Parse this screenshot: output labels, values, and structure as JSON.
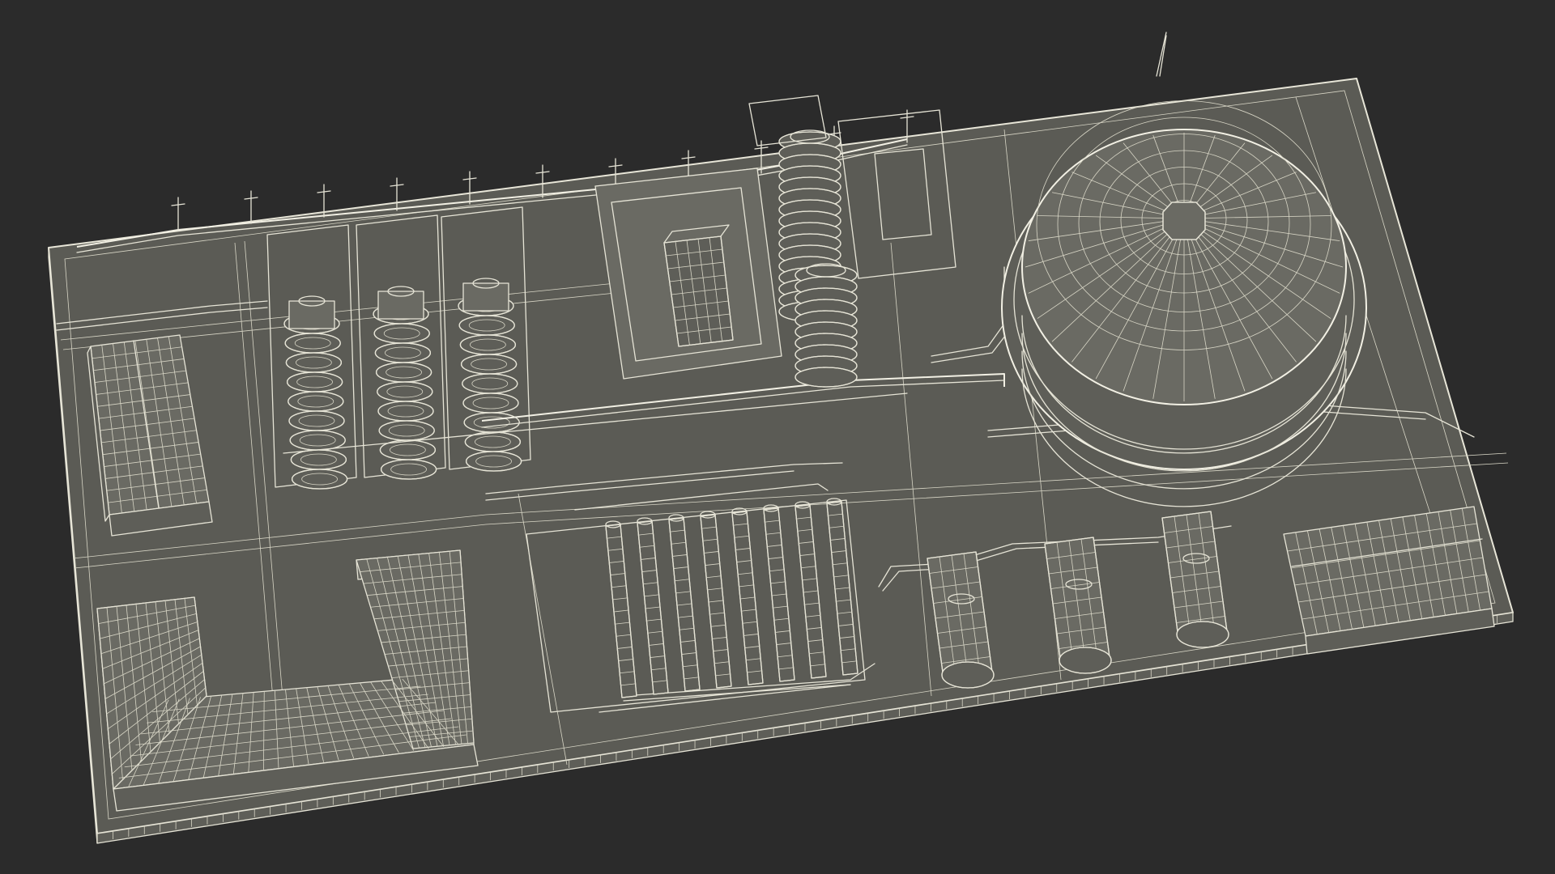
{
  "scene": {
    "background_color": "#2b2b2b",
    "wire_color": "#e6e4d6",
    "ground_color": "#5b5b55",
    "objects": [
      "ground-slab",
      "warehouse-building",
      "l-shaped-building",
      "distillation-columns",
      "central-process-unit",
      "spherical-storage-tank",
      "heat-exchanger-bank",
      "horizontal-tanks",
      "control-building",
      "pipe-racks",
      "antenna"
    ]
  }
}
